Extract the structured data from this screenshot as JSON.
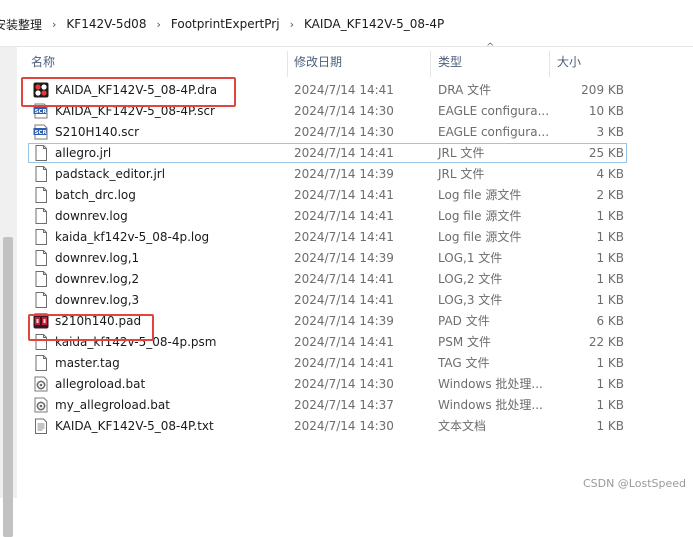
{
  "breadcrumb": [
    "安装整理",
    "KF142V-5d08",
    "FootprintExpertPrj",
    "KAIDA_KF142V-5_08-4P"
  ],
  "breadcrumb_separator": "›",
  "columns": {
    "name": "名称",
    "date": "修改日期",
    "type": "类型",
    "size": "大小"
  },
  "sort_indicator": "^",
  "files": [
    {
      "name": "KAIDA_KF142V-5_08-4P.dra",
      "date": "2024/7/14 14:41",
      "type": "DRA 文件",
      "size": "209 KB",
      "icon": "dra-file-icon"
    },
    {
      "name": "KAIDA_KF142V-5_08-4P.scr",
      "date": "2024/7/14 14:30",
      "type": "EAGLE configura...",
      "size": "10 KB",
      "icon": "scr-file-icon"
    },
    {
      "name": "S210H140.scr",
      "date": "2024/7/14 14:30",
      "type": "EAGLE configura...",
      "size": "3 KB",
      "icon": "scr-file-icon"
    },
    {
      "name": "allegro.jrl",
      "date": "2024/7/14 14:41",
      "type": "JRL 文件",
      "size": "25 KB",
      "icon": "generic-file-icon"
    },
    {
      "name": "padstack_editor.jrl",
      "date": "2024/7/14 14:39",
      "type": "JRL 文件",
      "size": "4 KB",
      "icon": "generic-file-icon"
    },
    {
      "name": "batch_drc.log",
      "date": "2024/7/14 14:41",
      "type": "Log file 源文件",
      "size": "2 KB",
      "icon": "generic-file-icon"
    },
    {
      "name": "downrev.log",
      "date": "2024/7/14 14:41",
      "type": "Log file 源文件",
      "size": "1 KB",
      "icon": "generic-file-icon"
    },
    {
      "name": "kaida_kf142v-5_08-4p.log",
      "date": "2024/7/14 14:41",
      "type": "Log file 源文件",
      "size": "1 KB",
      "icon": "generic-file-icon"
    },
    {
      "name": "downrev.log,1",
      "date": "2024/7/14 14:39",
      "type": "LOG,1 文件",
      "size": "1 KB",
      "icon": "generic-file-icon"
    },
    {
      "name": "downrev.log,2",
      "date": "2024/7/14 14:41",
      "type": "LOG,2 文件",
      "size": "1 KB",
      "icon": "generic-file-icon"
    },
    {
      "name": "downrev.log,3",
      "date": "2024/7/14 14:41",
      "type": "LOG,3 文件",
      "size": "1 KB",
      "icon": "generic-file-icon"
    },
    {
      "name": "s210h140.pad",
      "date": "2024/7/14 14:39",
      "type": "PAD 文件",
      "size": "6 KB",
      "icon": "pad-file-icon"
    },
    {
      "name": "kaida_kf142v-5_08-4p.psm",
      "date": "2024/7/14 14:41",
      "type": "PSM 文件",
      "size": "22 KB",
      "icon": "generic-file-icon"
    },
    {
      "name": "master.tag",
      "date": "2024/7/14 14:41",
      "type": "TAG 文件",
      "size": "1 KB",
      "icon": "generic-file-icon"
    },
    {
      "name": "allegroload.bat",
      "date": "2024/7/14 14:30",
      "type": "Windows 批处理...",
      "size": "1 KB",
      "icon": "bat-file-icon"
    },
    {
      "name": "my_allegroload.bat",
      "date": "2024/7/14 14:37",
      "type": "Windows 批处理...",
      "size": "1 KB",
      "icon": "bat-file-icon"
    },
    {
      "name": "KAIDA_KF142V-5_08-4P.txt",
      "date": "2024/7/14 14:30",
      "type": "文本文档",
      "size": "1 KB",
      "icon": "txt-file-icon"
    }
  ],
  "focused_row": 3,
  "highlighted_rows": [
    0,
    11
  ],
  "colors": {
    "highlight": "#e0463d",
    "focus_border": "#99c6e8",
    "header_text": "#4c607a"
  },
  "watermark": "CSDN @LostSpeed"
}
